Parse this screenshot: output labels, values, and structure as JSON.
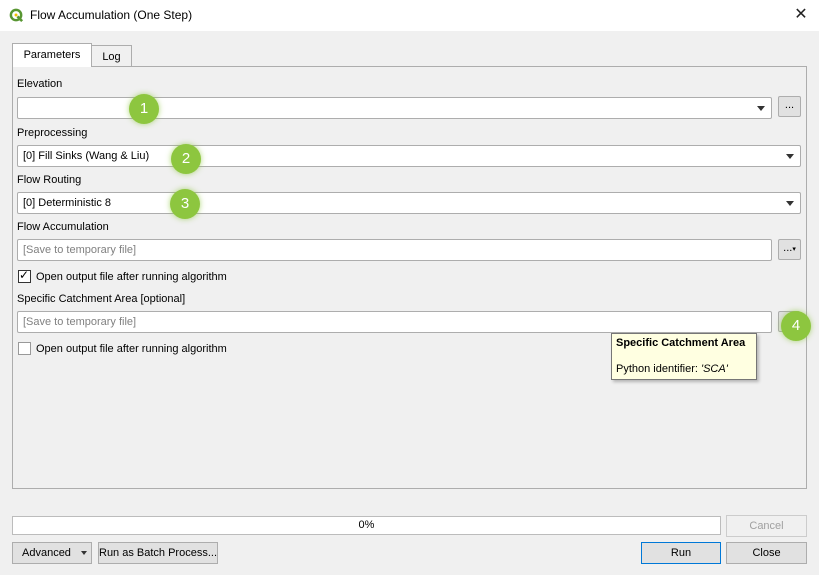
{
  "window": {
    "title": "Flow Accumulation (One Step)",
    "app_icon": "qgis-icon",
    "close_icon": "close-icon",
    "close_glyph": "✕"
  },
  "tabs": [
    {
      "label": "Parameters",
      "active": true
    },
    {
      "label": "Log",
      "active": false
    }
  ],
  "params": {
    "elevation": {
      "label": "Elevation",
      "value": "",
      "browse_label": "..."
    },
    "preprocessing": {
      "label": "Preprocessing",
      "value": "[0] Fill Sinks (Wang & Liu)"
    },
    "flow_routing": {
      "label": "Flow Routing",
      "value": "[0] Deterministic 8"
    },
    "flow_accumulation": {
      "label": "Flow Accumulation",
      "placeholder": "[Save to temporary file]",
      "browse_label": "...",
      "open_output_label": "Open output file after running algorithm",
      "open_output_checked": true
    },
    "sca": {
      "label": "Specific Catchment Area [optional]",
      "placeholder": "[Save to temporary file]",
      "open_output_label": "Open output file after running algorithm",
      "open_output_checked": false
    }
  },
  "badges": [
    "1",
    "2",
    "3",
    "4"
  ],
  "badge_color": "#8dc63f",
  "tooltip": {
    "title": "Specific Catchment Area",
    "prefix": "Python identifier: ",
    "identifier": "'SCA'"
  },
  "progress": {
    "text": "0%",
    "value": 0
  },
  "buttons": {
    "cancel": "Cancel",
    "advanced": "Advanced",
    "batch": "Run as Batch Process...",
    "run": "Run",
    "close": "Close"
  }
}
